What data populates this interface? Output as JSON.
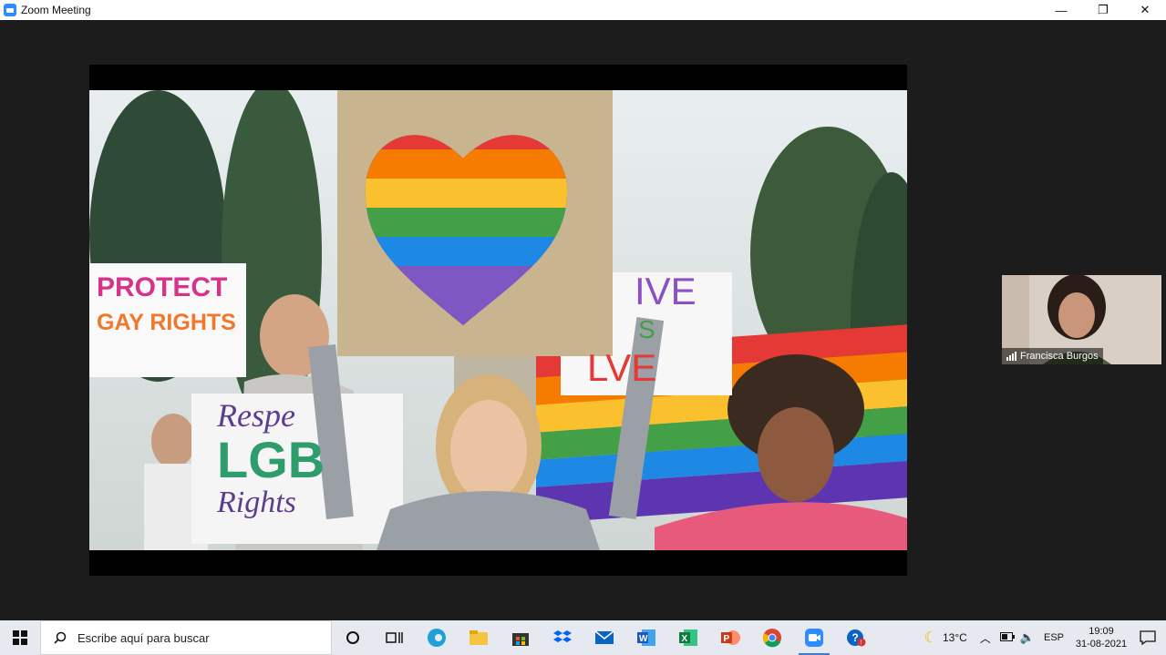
{
  "window": {
    "title": "Zoom Meeting",
    "controls": {
      "minimize": "—",
      "restore": "❐",
      "close": "✕"
    }
  },
  "meeting": {
    "participant_name": "Francisca Burgos",
    "signs": {
      "left_line1": "PROTECT",
      "left_line2": "GAY RIGHTS",
      "bottom_line1": "Respe",
      "bottom_line2": "LGB",
      "bottom_line3": "Rights",
      "right_line1": "IVE",
      "right_line2": "S",
      "right_line3": "LVE"
    }
  },
  "taskbar": {
    "search_placeholder": "Escribe aquí para buscar",
    "weather": "13°C",
    "language": "ESP",
    "time": "19:09",
    "date": "31-08-2021",
    "apps": [
      "cortana-icon",
      "task-view-icon",
      "edge-icon",
      "file-explorer-icon",
      "store-icon",
      "dropbox-icon",
      "mail-icon",
      "word-icon",
      "excel-icon",
      "powerpoint-icon",
      "chrome-icon",
      "zoom-icon",
      "help-icon"
    ]
  },
  "colors": {
    "accent": "#2d8cff",
    "rainbow": [
      "#e53935",
      "#f57c00",
      "#fbc02d",
      "#43a047",
      "#1e88e5",
      "#5e35b1"
    ]
  }
}
